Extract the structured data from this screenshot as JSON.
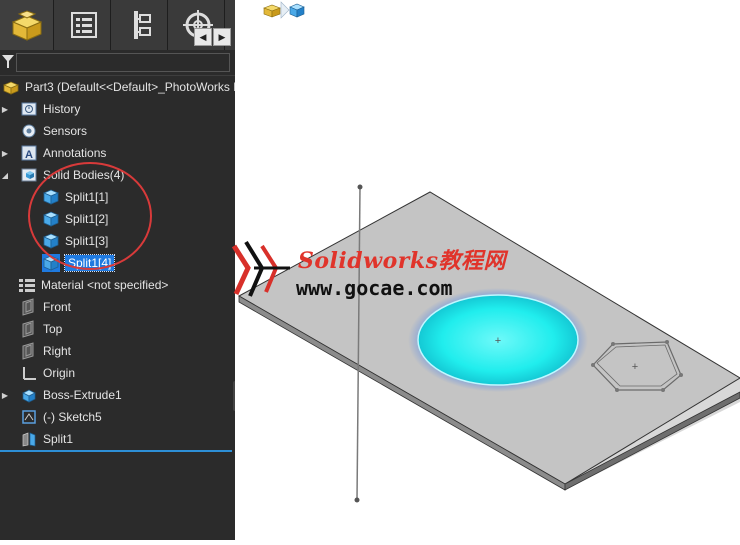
{
  "tree": {
    "root_label": "Part3  (Default<<Default>_PhotoWorks D",
    "items": [
      {
        "label": "History",
        "icon": "history-icon",
        "expander": true
      },
      {
        "label": "Sensors",
        "icon": "sensors-icon",
        "expander": false
      },
      {
        "label": "Annotations",
        "icon": "annotations-icon",
        "expander": true
      },
      {
        "label": "Solid Bodies(4)",
        "icon": "solid-bodies-folder-icon",
        "expander": true,
        "expanded": true
      },
      {
        "label": "Split1[1]",
        "icon": "solid-body-icon"
      },
      {
        "label": "Split1[2]",
        "icon": "solid-body-icon"
      },
      {
        "label": "Split1[3]",
        "icon": "solid-body-icon"
      },
      {
        "label": "Split1[4]",
        "icon": "solid-body-icon",
        "selected": true
      },
      {
        "label": "Material <not specified>",
        "icon": "material-icon"
      },
      {
        "label": "Front",
        "icon": "plane-icon"
      },
      {
        "label": "Top",
        "icon": "plane-icon"
      },
      {
        "label": "Right",
        "icon": "plane-icon"
      },
      {
        "label": "Origin",
        "icon": "origin-icon"
      },
      {
        "label": "Boss-Extrude1",
        "icon": "extrude-icon",
        "expander": true
      },
      {
        "label": "(-) Sketch5",
        "icon": "sketch-icon"
      },
      {
        "label": "Split1",
        "icon": "split-icon"
      }
    ]
  },
  "watermark": {
    "title": "Solidworks教程网",
    "url": "www.gocae.com"
  },
  "colors": {
    "panel_bg": "#2b2b2b",
    "selection": "#1f7ae0",
    "highlight_ring": "#d83a3a",
    "plate": "#c4c4c4",
    "disk": "#22f0f0"
  }
}
